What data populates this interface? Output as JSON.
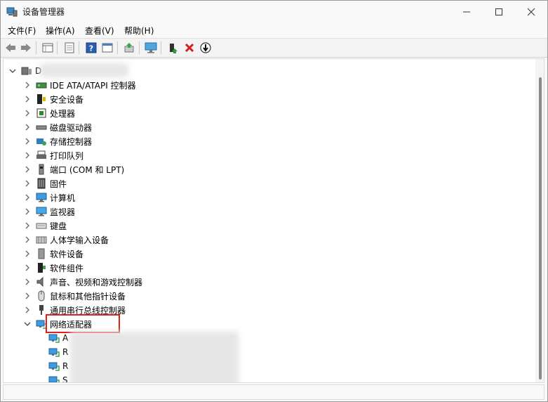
{
  "window": {
    "title": "设备管理器"
  },
  "menu": [
    "文件(F)",
    "操作(A)",
    "查看(V)",
    "帮助(H)"
  ],
  "tree": {
    "root": "D",
    "categories": [
      {
        "label": "IDE ATA/ATAPI 控制器",
        "icon": "ide-controller-icon"
      },
      {
        "label": "安全设备",
        "icon": "security-device-icon"
      },
      {
        "label": "处理器",
        "icon": "processor-icon"
      },
      {
        "label": "磁盘驱动器",
        "icon": "disk-drive-icon"
      },
      {
        "label": "存储控制器",
        "icon": "storage-controller-icon"
      },
      {
        "label": "打印队列",
        "icon": "printer-icon"
      },
      {
        "label": "端口 (COM 和 LPT)",
        "icon": "port-icon"
      },
      {
        "label": "固件",
        "icon": "firmware-icon"
      },
      {
        "label": "计算机",
        "icon": "computer-icon"
      },
      {
        "label": "监视器",
        "icon": "monitor-icon"
      },
      {
        "label": "键盘",
        "icon": "keyboard-icon"
      },
      {
        "label": "人体学输入设备",
        "icon": "hid-icon"
      },
      {
        "label": "软件设备",
        "icon": "software-device-icon"
      },
      {
        "label": "软件组件",
        "icon": "software-component-icon"
      },
      {
        "label": "声音、视频和游戏控制器",
        "icon": "audio-icon"
      },
      {
        "label": "鼠标和其他指针设备",
        "icon": "mouse-icon"
      },
      {
        "label": "通用串行总线控制器",
        "icon": "usb-icon"
      },
      {
        "label": "网络适配器",
        "icon": "network-adapter-icon"
      }
    ],
    "network_children": [
      "A",
      "R",
      "R",
      "S"
    ]
  }
}
